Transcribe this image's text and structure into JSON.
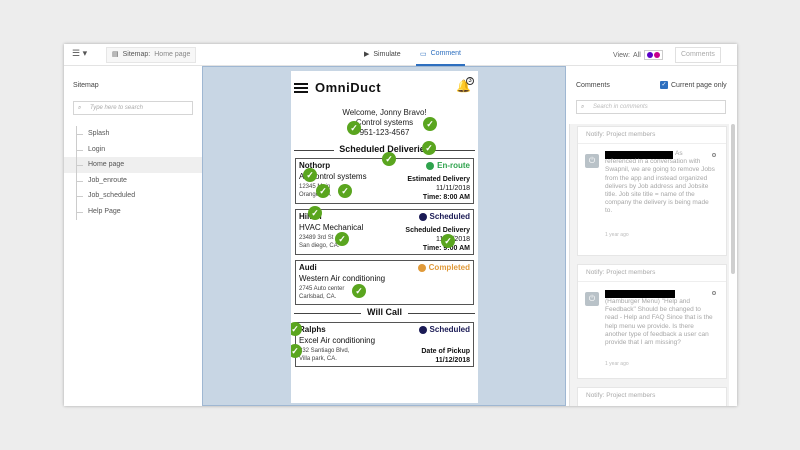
{
  "toolbar": {
    "menu_caret": "▾",
    "sitemap_label": "Sitemap:",
    "sitemap_page": "Home page",
    "simulate": "Simulate",
    "comment": "Comment",
    "view_label": "View:",
    "view_value": "All",
    "comments_button": "Comments",
    "view_dot_colors": [
      "#5a00c8",
      "#c8008c"
    ]
  },
  "sidebar": {
    "title": "Sitemap",
    "search_placeholder": "Type here to search",
    "items": [
      {
        "label": "Splash",
        "active": false
      },
      {
        "label": "Login",
        "active": false
      },
      {
        "label": "Home page",
        "active": true
      },
      {
        "label": "Job_enroute",
        "active": false
      },
      {
        "label": "Job_scheduled",
        "active": false
      },
      {
        "label": "Help Page",
        "active": false
      }
    ]
  },
  "phone": {
    "brand": "OmniDuct",
    "notification_count": "3",
    "welcome": "Welcome, Jonny Bravo!",
    "company_line": "Control systems",
    "phone_line": "951-123-4567",
    "scheduled_title": "Scheduled Deliveries",
    "will_call_title": "Will Call",
    "cards": [
      {
        "name": "Nothorp",
        "company": "Air control systems",
        "addr1": "12345 Main",
        "addr2": "Orange, CA",
        "status": "En-route",
        "status_color": "#2fa34d",
        "right_label": "Estimated Delivery",
        "date": "11/11/2018",
        "time": "Time: 8:00 AM"
      },
      {
        "name": "Hilton",
        "company": "HVAC Mechanical",
        "addr1": "23489 3rd St",
        "addr2": "San diego, CA.",
        "status": "Scheduled",
        "status_color": "#1a1a55",
        "right_label": "Scheduled Delivery",
        "date": "11/11/2018",
        "time": "Time: 9:00 AM"
      },
      {
        "name": "Audi",
        "company": "Western Air conditioning",
        "addr1": "2745 Auto center",
        "addr2": "Carlsbad, CA.",
        "status": "Completed",
        "status_color": "#e09a3a"
      },
      {
        "name": "Ralphs",
        "company": "Excel Air conditioning",
        "addr1": "232 Santiago Blvd,",
        "addr2": "Villa park, CA.",
        "status": "Scheduled",
        "status_color": "#1a1a55",
        "right_label": "Date of Pickup",
        "date": "11/12/2018"
      }
    ]
  },
  "comments_panel": {
    "title": "Comments",
    "current_only": "Current page only",
    "search_placeholder": "Search in comments",
    "comments": [
      {
        "notify": "Notify: Project members",
        "text": "As referenced in a conversation with Swapnil, we are going to remove Jobs from the app and instead organized delivers by Job address and Jobsite title. Job site title = name of the company the delivery is being made to.",
        "time": "1 year ago"
      },
      {
        "notify": "Notify: Project members",
        "text": "(Hamburger Menu) \"Help and Feedback\" Should be changed to read - Help and FAQ Since that is the help menu we provide. Is there another type of feedback a user can provide that I am missing?",
        "time": "1 year ago"
      },
      {
        "notify": "Notify: Project members"
      }
    ]
  }
}
